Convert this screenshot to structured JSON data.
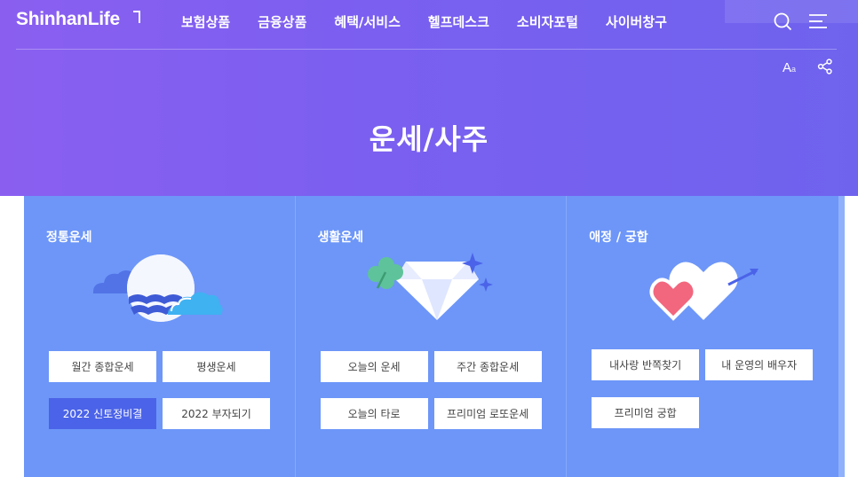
{
  "header": {
    "logo": "ShinhanLife",
    "nav": [
      "보험상품",
      "금융상품",
      "혜택/서비스",
      "헬프데스크",
      "소비자포털",
      "사이버창구"
    ],
    "font_size_big": "A",
    "font_size_small": "a"
  },
  "hero": {
    "title": "운세/사주"
  },
  "colors": {
    "hero": "#7a5ff0",
    "panel": "#6d96f8",
    "active_button": "#4b63e8"
  },
  "categories": [
    {
      "title": "정통운세",
      "illustration": "moon-cloud-wave-icon",
      "buttons": [
        "월간 종합운세",
        "평생운세",
        "2022 신토정비결",
        "2022 부자되기"
      ],
      "active": "2022 신토정비결"
    },
    {
      "title": "생활운세",
      "illustration": "clover-diamond-icon",
      "buttons": [
        "오늘의 운세",
        "주간 종합운세",
        "오늘의 타로",
        "프리미엄 로또운세"
      ]
    },
    {
      "title": "애정 / 궁합",
      "illustration": "hearts-arrow-icon",
      "buttons": [
        "내사랑 반쪽찾기",
        "내 운영의 배우자",
        "프리미엄 궁합"
      ]
    }
  ]
}
